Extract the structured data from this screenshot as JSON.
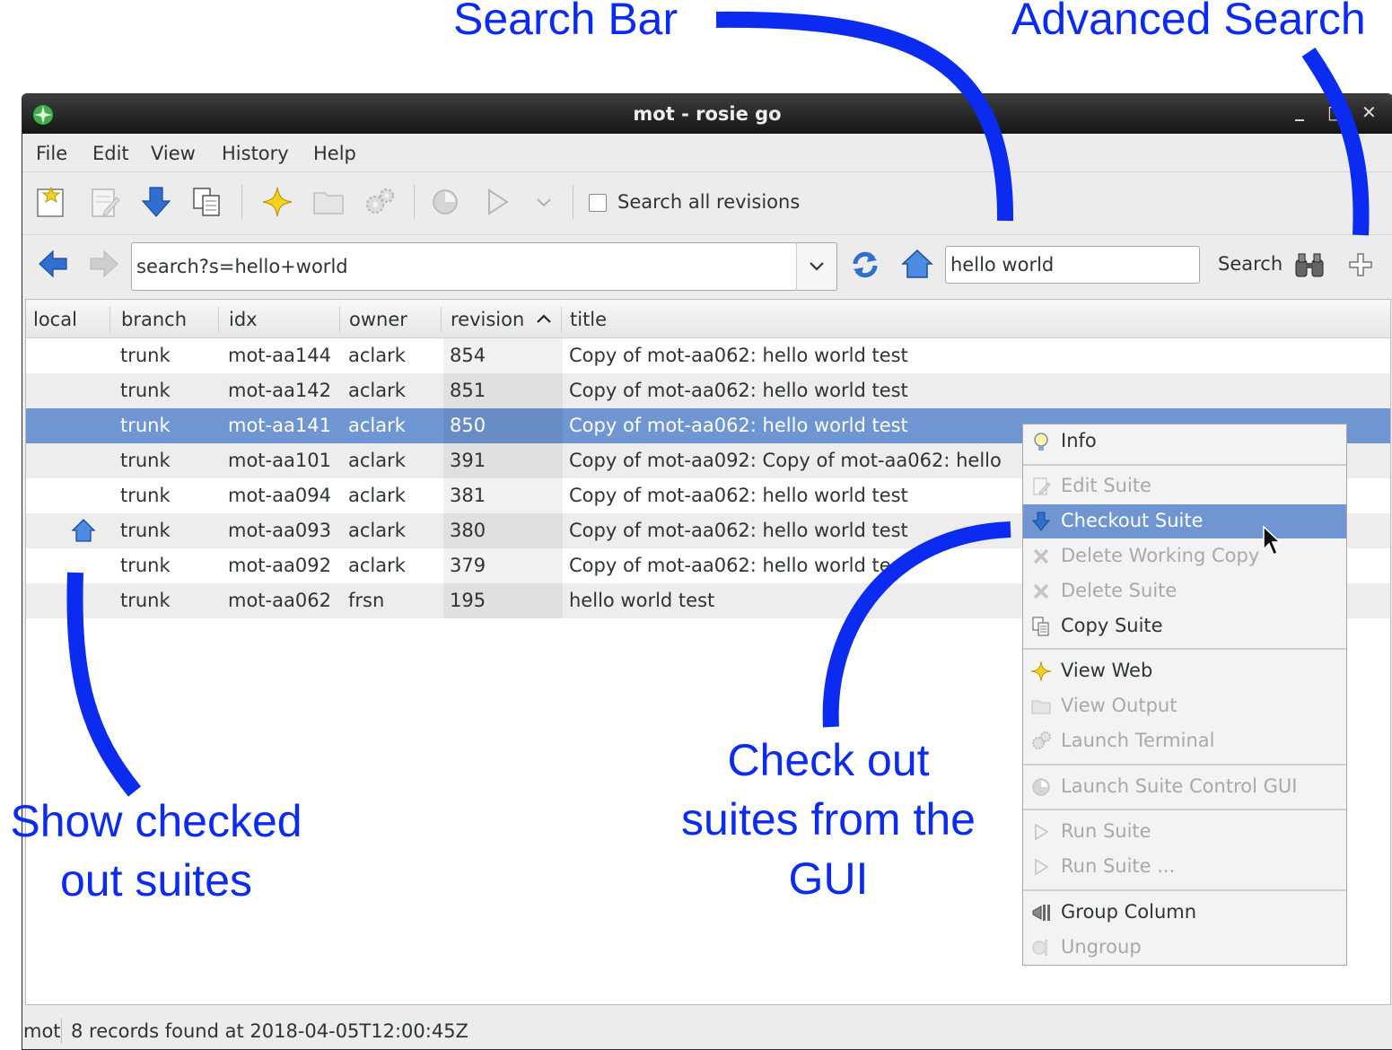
{
  "annotations": {
    "search_bar": "Search Bar",
    "advanced_search": "Advanced Search",
    "show_checked_line1": "Show checked",
    "show_checked_line2": "out suites",
    "checkout_line1": "Check out",
    "checkout_line2": "suites from the",
    "checkout_line3": "GUI"
  },
  "window": {
    "title": "mot - rosie go",
    "controls": {
      "minimize": "_",
      "maximize": "□",
      "close": "✕"
    }
  },
  "menubar": [
    "File",
    "Edit",
    "View",
    "History",
    "Help"
  ],
  "toolbar": {
    "icons": [
      "new-suite-icon",
      "edit-suite-icon",
      "checkout-icon",
      "copy-suite-icon",
      "view-web-icon",
      "view-output-icon",
      "launch-terminal-icon",
      "suite-control-icon",
      "run-suite-icon",
      "run-dropdown-icon"
    ],
    "search_all_revisions": {
      "label": "Search all revisions",
      "checked": false
    }
  },
  "navbar": {
    "address": "search?s=hello+world",
    "search_text": "hello world",
    "search_label": "Search"
  },
  "table": {
    "columns": [
      "local",
      "branch",
      "idx",
      "owner",
      "revision",
      "title"
    ],
    "sort_column": "revision",
    "rows": [
      {
        "local": "",
        "branch": "trunk",
        "idx": "mot-aa144",
        "owner": "aclark",
        "revision": "854",
        "title": "Copy of mot-aa062: hello world test"
      },
      {
        "local": "",
        "branch": "trunk",
        "idx": "mot-aa142",
        "owner": "aclark",
        "revision": "851",
        "title": "Copy of mot-aa062: hello world test"
      },
      {
        "local": "",
        "branch": "trunk",
        "idx": "mot-aa141",
        "owner": "aclark",
        "revision": "850",
        "title": "Copy of mot-aa062: hello world test",
        "selected": true
      },
      {
        "local": "",
        "branch": "trunk",
        "idx": "mot-aa101",
        "owner": "aclark",
        "revision": "391",
        "title": "Copy of mot-aa092: Copy of mot-aa062: hello"
      },
      {
        "local": "",
        "branch": "trunk",
        "idx": "mot-aa094",
        "owner": "aclark",
        "revision": "381",
        "title": "Copy of mot-aa062: hello world test"
      },
      {
        "local": "home-icon",
        "branch": "trunk",
        "idx": "mot-aa093",
        "owner": "aclark",
        "revision": "380",
        "title": "Copy of mot-aa062: hello world test"
      },
      {
        "local": "",
        "branch": "trunk",
        "idx": "mot-aa092",
        "owner": "aclark",
        "revision": "379",
        "title": "Copy of mot-aa062: hello world test"
      },
      {
        "local": "",
        "branch": "trunk",
        "idx": "mot-aa062",
        "owner": "frsn",
        "revision": "195",
        "title": "hello world test"
      }
    ]
  },
  "context_menu": {
    "items": [
      {
        "label": "Info",
        "icon": "info-icon",
        "enabled": true
      },
      {
        "label": "Edit Suite",
        "icon": "edit-icon",
        "enabled": false
      },
      {
        "label": "Checkout Suite",
        "icon": "checkout-icon",
        "enabled": true,
        "highlighted": true
      },
      {
        "label": "Delete Working Copy",
        "icon": "delete-icon",
        "enabled": false
      },
      {
        "label": "Delete Suite",
        "icon": "delete-icon",
        "enabled": false
      },
      {
        "label": "Copy Suite",
        "icon": "copy-icon",
        "enabled": true
      },
      {
        "label": "View Web",
        "icon": "web-icon",
        "enabled": true
      },
      {
        "label": "View Output",
        "icon": "folder-icon",
        "enabled": false
      },
      {
        "label": "Launch Terminal",
        "icon": "terminal-icon",
        "enabled": false
      },
      {
        "label": "Launch Suite Control GUI",
        "icon": "control-gui-icon",
        "enabled": false
      },
      {
        "label": "Run Suite",
        "icon": "run-icon",
        "enabled": false
      },
      {
        "label": "Run Suite ...",
        "icon": "run-icon",
        "enabled": false
      },
      {
        "label": "Group Column",
        "icon": "group-icon",
        "enabled": true
      },
      {
        "label": "Ungroup",
        "icon": "ungroup-icon",
        "enabled": false
      }
    ]
  },
  "statusbar": {
    "prefix": "mot",
    "message": "8 records found at 2018-04-05T12:00:45Z"
  },
  "colors": {
    "annotation": "#0b2cf0",
    "selection": "#6f96d3",
    "icon_blue": "#2f6fd0"
  }
}
